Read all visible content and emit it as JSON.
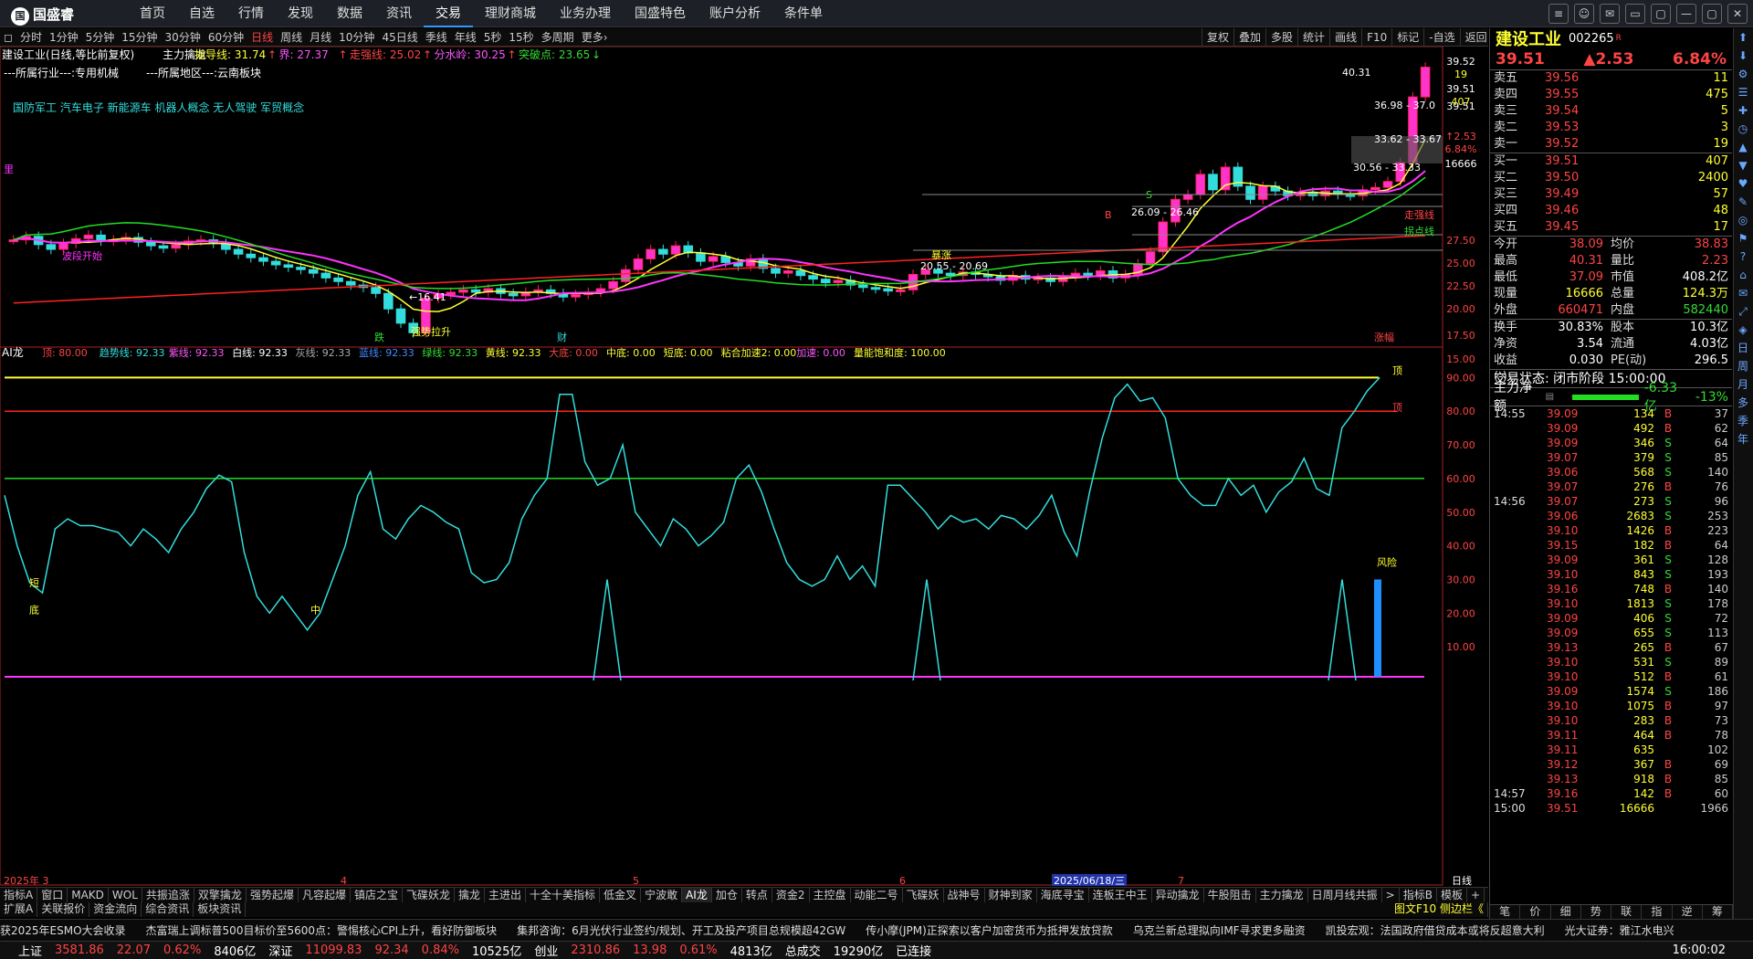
{
  "app": {
    "logo": "国盛睿",
    "logo_mark": "国"
  },
  "menu": [
    "首页",
    "自选",
    "行情",
    "发现",
    "数据",
    "资讯",
    "交易",
    "理财商城",
    "业务办理",
    "国盛特色",
    "账户分析",
    "条件单"
  ],
  "window_buttons": [
    "≡",
    "☺",
    "✉",
    "▭",
    "▢",
    "—",
    "▢",
    "✕"
  ],
  "periods": [
    "分时",
    "1分钟",
    "5分钟",
    "15分钟",
    "30分钟",
    "60分钟",
    "日线",
    "周线",
    "月线",
    "10分钟",
    "45日线",
    "季线",
    "年线",
    "5秒",
    "15秒",
    "多周期",
    "更多›"
  ],
  "chart_buttons": [
    "复权",
    "叠加",
    "多股",
    "统计",
    "画线",
    "F10",
    "标记",
    "-自选",
    "返回"
  ],
  "stock": {
    "header": "建设工业(日线,等比前复权)",
    "industry": "---所属行业---:专用机械",
    "region": "---所属地区---:云南板块",
    "concepts": "国防军工 汽车电子 新能源车 机器人概念 无人驾驶 军贸概念",
    "ind_line": [
      {
        "t": "主力擒龙",
        "c": "#fff"
      },
      {
        "t": "指导线: 31.74",
        "c": "#ffff33"
      },
      {
        "t": "↑",
        "c": "#ff4444"
      },
      {
        "t": "界: 27.37",
        "c": "#ff55ff"
      },
      {
        "t": "↑",
        "c": "#ff4444"
      },
      {
        "t": "走强线: 25.02",
        "c": "#ff4444"
      },
      {
        "t": "↑",
        "c": "#ff4444"
      },
      {
        "t": "分水岭: 30.25",
        "c": "#ff55ff"
      },
      {
        "t": "↑",
        "c": "#ff4444"
      },
      {
        "t": "突破点: 23.65",
        "c": "#33dd33"
      },
      {
        "t": "↓",
        "c": "#33dd33"
      }
    ]
  },
  "main_chart": {
    "price_labels": [
      "39.52",
      "39.51",
      "39.51",
      "27.50",
      "25.00",
      "22.50",
      "20.00",
      "17.50",
      "15.00"
    ],
    "aux_labels": [
      "19",
      "407",
      "↑2.53",
      "6.84%",
      "16666"
    ],
    "annotations": [
      "40.31",
      "36.98 - 37.0",
      "33.62 - 33.67",
      "30.56 - 33.33",
      "26.09 - 26.46",
      "20.55 - 20.69",
      "←16.41",
      "走强线",
      "拐点线",
      "暴涨",
      "波段开始",
      "强势拉升",
      "跌",
      "财",
      "涨幅",
      "B",
      "S",
      "里"
    ]
  },
  "ai_panel": {
    "title": "AI龙",
    "values": [
      {
        "t": "顶: 80.00",
        "c": "#ff4444"
      },
      {
        "t": "趋势线: 92.33",
        "c": "#33dddd"
      },
      {
        "t": "紫线: 92.33",
        "c": "#ff55ff"
      },
      {
        "t": "白线: 92.33",
        "c": "#fff"
      },
      {
        "t": "灰线: 92.33",
        "c": "#aaa"
      },
      {
        "t": "蓝线: 92.33",
        "c": "#4488ff"
      },
      {
        "t": "绿线: 92.33",
        "c": "#33dd33"
      },
      {
        "t": "黄线: 92.33",
        "c": "#ffff33"
      },
      {
        "t": "大底: 0.00",
        "c": "#ff4444"
      },
      {
        "t": "中底: 0.00",
        "c": "#ffff33"
      },
      {
        "t": "短底: 0.00",
        "c": "#ffff33"
      },
      {
        "t": "粘合加速2: 0.00",
        "c": "#ffff33"
      },
      {
        "t": "加速: 0.00",
        "c": "#ff55ff"
      },
      {
        "t": "量能饱和度: 100.00",
        "c": "#ffff33"
      }
    ],
    "y_labels": [
      "90.00",
      "80.00",
      "70.00",
      "60.00",
      "50.00",
      "40.00",
      "30.00",
      "20.00",
      "10.00"
    ],
    "marks": [
      "顶",
      "顶",
      "风险",
      "短",
      "底",
      "中"
    ]
  },
  "x_axis": {
    "labels": [
      "2025年 3",
      "4",
      "5",
      "6",
      "7"
    ],
    "cursor_date": "2025/06/18/三",
    "period": "日线"
  },
  "indicator_tabs": [
    "指标A",
    "窗口",
    "MAKD",
    "WOL",
    "共振追涨",
    "双擎擒龙",
    "强势起爆",
    "凡容起爆",
    "镇店之宝",
    "飞碟妖龙",
    "擒龙",
    "主进出",
    "十全十美指标",
    "低金叉",
    "宁波敢",
    "AI龙",
    "加仓",
    "转点",
    "资金2",
    "主控盘",
    "动能二号",
    "飞碟妖",
    "战神号",
    "财神到家",
    "海底寻宝",
    "连板王中王",
    "异动擒龙",
    "牛股阻击",
    "主力擒龙",
    "日周月线共振",
    ">",
    "指标B",
    "模板",
    "+",
    "-"
  ],
  "indicator_tabs_active": "AI龙",
  "bottom_tabs": [
    "扩展A",
    "关联报价",
    "资金流向",
    "综合资讯",
    "板块资讯"
  ],
  "bottom_right": "图文F10 侧边栏《",
  "news": [
    "获2025年ESMO大会收录",
    "杰富瑞上调标普500目标价至5600点：警惕核心CPI上升，看好防御板块",
    "集邦咨询：6月光伏行业签约/规划、开工及投产项目总规模超42GW",
    "传小摩(JPM)正探索以客户加密货币为抵押发放贷款",
    "乌克兰新总理拟向IMF寻求更多融资",
    "凯投宏观：法国政府借贷成本或将反超意大利",
    "光大证券：雅江水电兴"
  ],
  "status": {
    "items": [
      {
        "t": "上证",
        "c": "#fff"
      },
      {
        "t": "3581.86",
        "c": "#ff4444"
      },
      {
        "t": "22.07",
        "c": "#ff4444"
      },
      {
        "t": "0.62%",
        "c": "#ff4444"
      },
      {
        "t": "8406亿",
        "c": "#fff"
      },
      {
        "t": "深证",
        "c": "#fff"
      },
      {
        "t": "11099.83",
        "c": "#ff4444"
      },
      {
        "t": "92.34",
        "c": "#ff4444"
      },
      {
        "t": "0.84%",
        "c": "#ff4444"
      },
      {
        "t": "10525亿",
        "c": "#fff"
      },
      {
        "t": "创业",
        "c": "#fff"
      },
      {
        "t": "2310.86",
        "c": "#ff4444"
      },
      {
        "t": "13.98",
        "c": "#ff4444"
      },
      {
        "t": "0.61%",
        "c": "#ff4444"
      },
      {
        "t": "4813亿",
        "c": "#fff"
      },
      {
        "t": "总成交",
        "c": "#fff"
      },
      {
        "t": "19290亿",
        "c": "#fff"
      },
      {
        "t": "已连接",
        "c": "#fff"
      }
    ],
    "time": "16:00:02"
  },
  "quote": {
    "name": "建设工业",
    "code": "002265",
    "code_tag": "R",
    "price": "39.51",
    "change": "▲2.53",
    "pct": "6.84%"
  },
  "orderbook": {
    "ask": [
      {
        "l": "卖五",
        "p": "39.56",
        "v": "11"
      },
      {
        "l": "卖四",
        "p": "39.55",
        "v": "475"
      },
      {
        "l": "卖三",
        "p": "39.54",
        "v": "5"
      },
      {
        "l": "卖二",
        "p": "39.53",
        "v": "3"
      },
      {
        "l": "卖一",
        "p": "39.52",
        "v": "19"
      }
    ],
    "bid": [
      {
        "l": "买一",
        "p": "39.51",
        "v": "407"
      },
      {
        "l": "买二",
        "p": "39.50",
        "v": "2400"
      },
      {
        "l": "买三",
        "p": "39.49",
        "v": "57"
      },
      {
        "l": "买四",
        "p": "39.46",
        "v": "48"
      },
      {
        "l": "买五",
        "p": "39.45",
        "v": "17"
      }
    ]
  },
  "stats": [
    {
      "l": "今开",
      "v": "38.09",
      "c": "#ff4444",
      "l2": "均价",
      "v2": "38.83",
      "c2": "#ff4444"
    },
    {
      "l": "最高",
      "v": "40.31",
      "c": "#ff4444",
      "l2": "量比",
      "v2": "2.23",
      "c2": "#ff4444"
    },
    {
      "l": "最低",
      "v": "37.09",
      "c": "#ff4444",
      "l2": "市值",
      "v2": "408.2亿",
      "c2": "#fff"
    },
    {
      "l": "现量",
      "v": "16666",
      "c": "#ffff33",
      "l2": "总量",
      "v2": "124.3万",
      "c2": "#ffff33"
    },
    {
      "l": "外盘",
      "v": "660471",
      "c": "#ff4444",
      "l2": "内盘",
      "v2": "582440",
      "c2": "#33dd33"
    }
  ],
  "stats2": [
    {
      "l": "换手",
      "v": "30.83%",
      "c": "#fff",
      "l2": "股本",
      "v2": "10.3亿",
      "c2": "#fff"
    },
    {
      "l": "净资",
      "v": "3.54",
      "c": "#fff",
      "l2": "流通",
      "v2": "4.03亿",
      "c2": "#fff"
    },
    {
      "l": "收益(-)",
      "v": "0.030",
      "c": "#fff",
      "l2": "PE(动)",
      "v2": "296.5",
      "c2": "#fff"
    }
  ],
  "trade_state": "交易状态: 闭市阶段 15:00:00",
  "netflow": {
    "label": "主力净额",
    "value": "-6.33亿",
    "pct": "-13%"
  },
  "ticks": [
    {
      "t": "14:55",
      "p": "39.09",
      "v": "134",
      "d": "B",
      "n": "37"
    },
    {
      "t": "",
      "p": "39.09",
      "v": "492",
      "d": "B",
      "n": "62"
    },
    {
      "t": "",
      "p": "39.09",
      "v": "346",
      "d": "S",
      "n": "64"
    },
    {
      "t": "",
      "p": "39.07",
      "v": "379",
      "d": "S",
      "n": "85"
    },
    {
      "t": "",
      "p": "39.06",
      "v": "568",
      "d": "S",
      "n": "140"
    },
    {
      "t": "",
      "p": "39.07",
      "v": "276",
      "d": "B",
      "n": "76"
    },
    {
      "t": "14:56",
      "p": "39.07",
      "v": "273",
      "d": "S",
      "n": "96"
    },
    {
      "t": "",
      "p": "39.06",
      "v": "2683",
      "d": "S",
      "n": "253"
    },
    {
      "t": "",
      "p": "39.10",
      "v": "1426",
      "d": "B",
      "n": "223"
    },
    {
      "t": "",
      "p": "39.15",
      "v": "182",
      "d": "B",
      "n": "64"
    },
    {
      "t": "",
      "p": "39.09",
      "v": "361",
      "d": "S",
      "n": "128"
    },
    {
      "t": "",
      "p": "39.10",
      "v": "843",
      "d": "S",
      "n": "193"
    },
    {
      "t": "",
      "p": "39.16",
      "v": "748",
      "d": "B",
      "n": "140"
    },
    {
      "t": "",
      "p": "39.10",
      "v": "1813",
      "d": "S",
      "n": "178"
    },
    {
      "t": "",
      "p": "39.09",
      "v": "406",
      "d": "S",
      "n": "72"
    },
    {
      "t": "",
      "p": "39.09",
      "v": "655",
      "d": "S",
      "n": "113"
    },
    {
      "t": "",
      "p": "39.13",
      "v": "265",
      "d": "B",
      "n": "67"
    },
    {
      "t": "",
      "p": "39.10",
      "v": "531",
      "d": "S",
      "n": "89"
    },
    {
      "t": "",
      "p": "39.10",
      "v": "512",
      "d": "B",
      "n": "61"
    },
    {
      "t": "",
      "p": "39.09",
      "v": "1574",
      "d": "S",
      "n": "186"
    },
    {
      "t": "",
      "p": "39.10",
      "v": "1075",
      "d": "B",
      "n": "97"
    },
    {
      "t": "",
      "p": "39.10",
      "v": "283",
      "d": "B",
      "n": "73"
    },
    {
      "t": "",
      "p": "39.11",
      "v": "464",
      "d": "B",
      "n": "78"
    },
    {
      "t": "",
      "p": "39.11",
      "v": "635",
      "d": "",
      "n": "102"
    },
    {
      "t": "",
      "p": "39.12",
      "v": "367",
      "d": "B",
      "n": "69"
    },
    {
      "t": "",
      "p": "39.13",
      "v": "918",
      "d": "B",
      "n": "85"
    },
    {
      "t": "14:57",
      "p": "39.16",
      "v": "142",
      "d": "B",
      "n": "60"
    },
    {
      "t": "15:00",
      "p": "39.51",
      "v": "16666",
      "d": "",
      "n": "1966"
    }
  ],
  "rp_tabs": [
    "笔",
    "价",
    "细",
    "势",
    "联",
    "指",
    "逆",
    "筹"
  ],
  "side_icons": [
    "⬆",
    "⬇",
    "⚙",
    "☰",
    "✚",
    "◷",
    "▲",
    "▼",
    "♥",
    "✎",
    "◎",
    "⚑",
    "?",
    "⌂",
    "✉",
    "⤢",
    "◈",
    "日",
    "周",
    "月",
    "多",
    "季",
    "年"
  ]
}
